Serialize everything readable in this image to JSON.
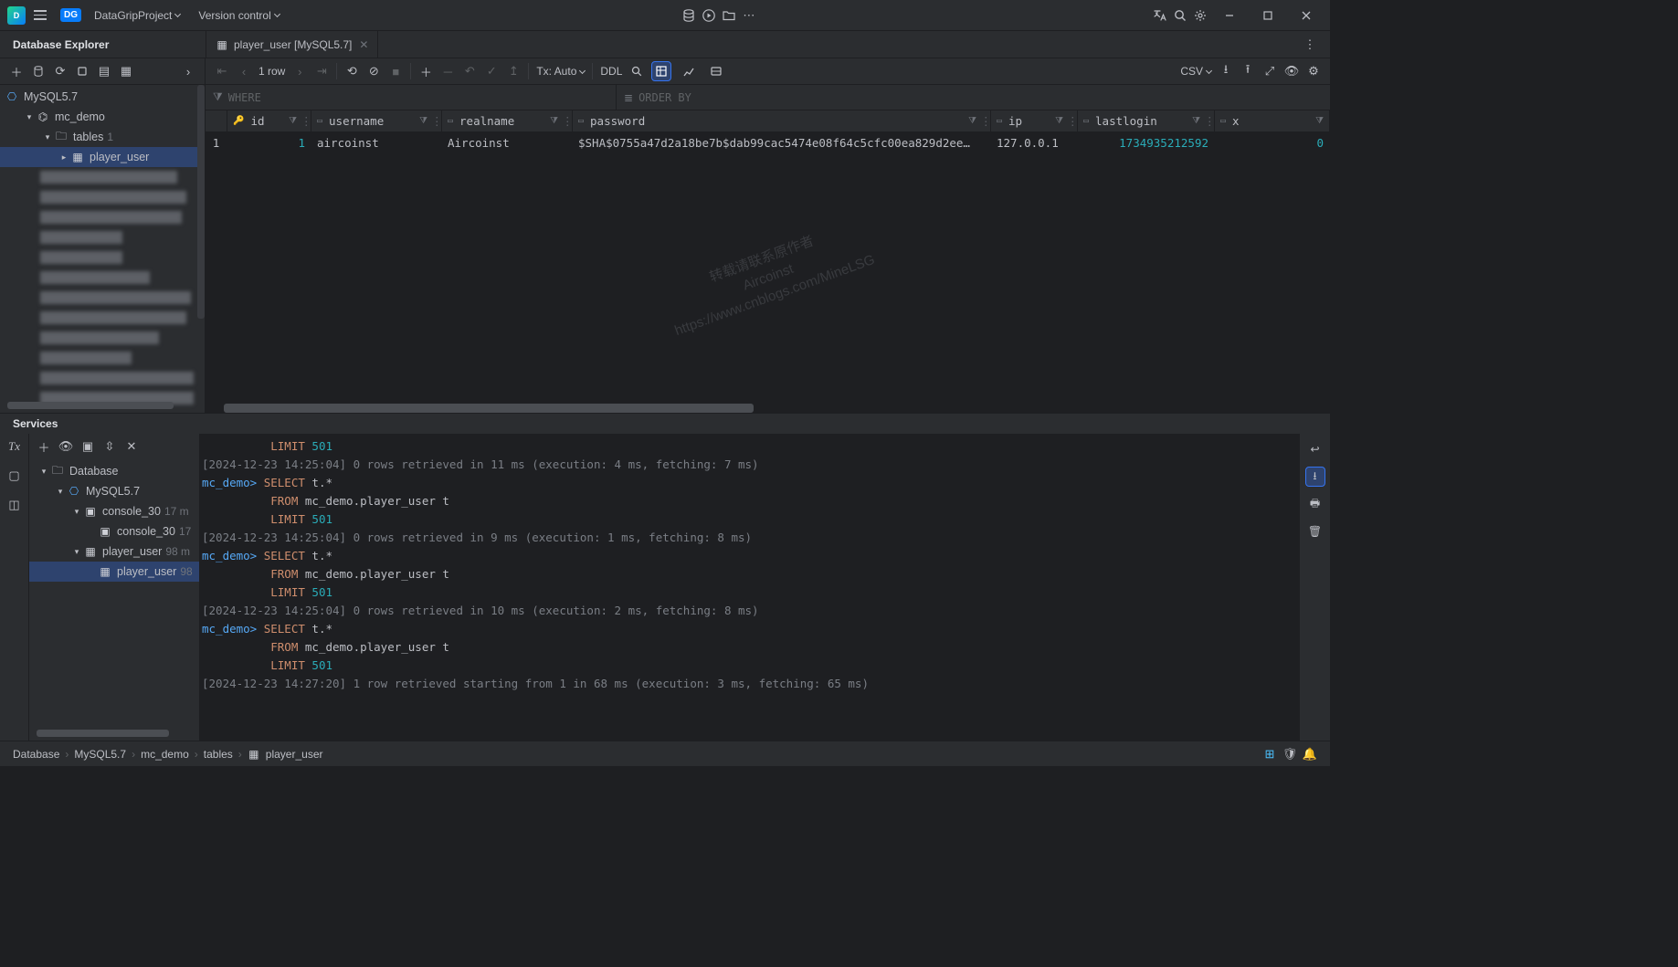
{
  "titlebar": {
    "project_name": "DataGripProject",
    "version_control_label": "Version control"
  },
  "toolwindow": {
    "left_title": "Database Explorer",
    "tab_label": "player_user [MySQL5.7]",
    "services_title": "Services"
  },
  "db_tree": {
    "datasource": "MySQL5.7",
    "schema": "mc_demo",
    "tables_label": "tables",
    "tables_count": "1",
    "table": "player_user"
  },
  "editor_toolbar": {
    "row_count": "1 row",
    "tx_mode": "Tx: Auto",
    "ddl_label": "DDL",
    "export_format": "CSV"
  },
  "filters": {
    "where_placeholder": "WHERE",
    "orderby_placeholder": "ORDER BY"
  },
  "columns": {
    "id": "id",
    "username": "username",
    "realname": "realname",
    "password": "password",
    "ip": "ip",
    "lastlogin": "lastlogin",
    "x": "x"
  },
  "row": {
    "idx": "1",
    "id": "1",
    "username": "aircoinst",
    "realname": "Aircoinst",
    "password": "$SHA$0755a47d2a18be7b$dab99cac5474e08f64c5cfc00ea829d2ee…",
    "ip": "127.0.0.1",
    "lastlogin": "1734935212592",
    "x": "0"
  },
  "watermark": "转载请联系原作者\nAircoinst\nhttps://www.cnblogs.com/MineLSG",
  "services_tree": {
    "root": "Database",
    "ds": "MySQL5.7",
    "console_grp": "console_30",
    "console_grp_meta": "17 m",
    "console_item": "console_30",
    "console_item_meta": "17",
    "table_grp": "player_user",
    "table_grp_meta": "98 m",
    "prompt": "mc_demo>",
    "table_item": "player_user",
    "table_item_meta": "98"
  },
  "console": {
    "l1_a": "          LIMIT ",
    "l1_b": "501",
    "l2": "[2024-12-23 14:25:04] 0 rows retrieved in 11 ms (execution: 4 ms, fetching: 7 ms)",
    "l3_a": "mc_demo> ",
    "l3_b": "SELECT",
    "l3_c": " t.*",
    "l4_a": "          FROM",
    "l4_b": " mc_demo.player_user t",
    "l5_a": "          LIMIT ",
    "l5_b": "501",
    "l6": "[2024-12-23 14:25:04] 0 rows retrieved in 9 ms (execution: 1 ms, fetching: 8 ms)",
    "l7_a": "mc_demo> ",
    "l7_b": "SELECT",
    "l7_c": " t.*",
    "l8_a": "          FROM",
    "l8_b": " mc_demo.player_user t",
    "l9_a": "          LIMIT ",
    "l9_b": "501",
    "l10": "[2024-12-23 14:25:04] 0 rows retrieved in 10 ms (execution: 2 ms, fetching: 8 ms)",
    "l11_a": "mc_demo> ",
    "l11_b": "SELECT",
    "l11_c": " t.*",
    "l12_a": "          FROM",
    "l12_b": " mc_demo.player_user t",
    "l13_a": "          LIMIT ",
    "l13_b": "501",
    "l14": "[2024-12-23 14:27:20] 1 row retrieved starting from 1 in 68 ms (execution: 3 ms, fetching: 65 ms)"
  },
  "breadcrumbs": {
    "c1": "Database",
    "c2": "MySQL5.7",
    "c3": "mc_demo",
    "c4": "tables",
    "c5": "player_user"
  }
}
